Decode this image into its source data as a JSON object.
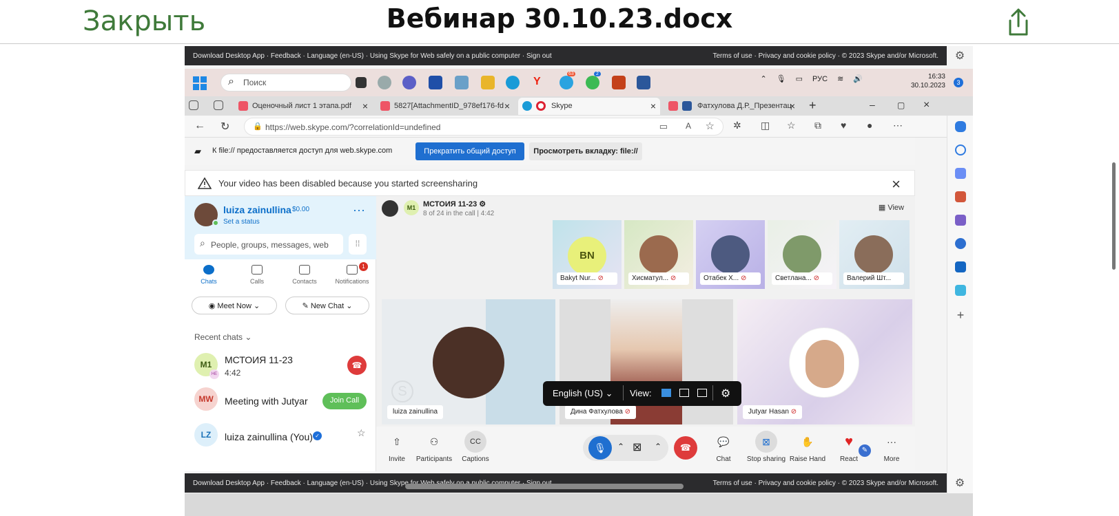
{
  "viewer": {
    "close_label": "Закрыть",
    "title": "Вебинар 30.10.23.docx",
    "share_icon": "share-icon"
  },
  "skype_footer": {
    "download": "Download Desktop App",
    "feedback": "Feedback",
    "language": "Language (en-US)",
    "public": "Using Skype for Web safely on a public computer",
    "signout": "Sign out",
    "terms": "Terms of use",
    "privacy": "Privacy and cookie policy",
    "copyright": "© 2023 Skype and/or Microsoft."
  },
  "taskbar": {
    "search_placeholder": "Поиск",
    "lang": "РУС",
    "time": "16:33",
    "date": "30.10.2023",
    "notif_count": "3",
    "badge_2": "2",
    "badge_3": "63"
  },
  "tabs": [
    {
      "label": "Оценочный лист 1 этапа.pdf"
    },
    {
      "label": "5827[AttachmentID_978ef176-fd"
    },
    {
      "label": "Skype"
    },
    {
      "label": "Фатхулова Д.Р._Презентац"
    }
  ],
  "address": {
    "url": "https://web.skype.com/?correlationId=undefined"
  },
  "sharebar": {
    "text": "К file:// предоставляется доступ для web.skype.com",
    "stop_label": "Прекратить общий доступ",
    "view_label": "Просмотреть вкладку: file://"
  },
  "warning": {
    "text": "Your video has been disabled because you started screensharing"
  },
  "profile": {
    "name": "luiza zainullina",
    "balance": "$0.00",
    "status": "Set a status",
    "search_placeholder": "People, groups, messages, web"
  },
  "nav": [
    {
      "label": "Chats"
    },
    {
      "label": "Calls"
    },
    {
      "label": "Contacts"
    },
    {
      "label": "Notifications",
      "badge": "1"
    }
  ],
  "buttons": {
    "meet_now": "Meet Now",
    "new_chat": "New Chat"
  },
  "recent": {
    "header": "Recent chats",
    "chats": [
      {
        "initials": "M1",
        "name": "МСТОИЯ 11-23",
        "sub": "4:42",
        "mini": "НЕ"
      },
      {
        "initials": "MW",
        "name": "Meeting with Jutyar",
        "action": "Join Call"
      },
      {
        "initials": "LZ",
        "name": "luiza zainullina (You)"
      }
    ]
  },
  "call": {
    "group_initials": "M1",
    "title": "МСТОИЯ 11-23",
    "subtitle": "8 of 24 in the call | 4:42",
    "view_label": "View",
    "thumbs": [
      {
        "label": "Bakyt Nur...",
        "initials": "BN"
      },
      {
        "label": "Хисматул..."
      },
      {
        "label": "Отабек Х..."
      },
      {
        "label": "Светлана..."
      },
      {
        "label": "Валерий Шт..."
      }
    ],
    "tiles": [
      {
        "label": "luiza zainullina"
      },
      {
        "label": "Дина Фатхулова"
      },
      {
        "label": "Jutyar Hasan"
      }
    ],
    "captions": {
      "language": "English (US)",
      "view": "View:"
    },
    "controls": {
      "invite": "Invite",
      "participants": "Participants",
      "captions": "Captions",
      "chat": "Chat",
      "stop_sharing": "Stop sharing",
      "raise_hand": "Raise Hand",
      "react": "React",
      "more": "More"
    }
  },
  "colors": {
    "accent": "#0b6ec9",
    "stop_button": "#1f6fd0",
    "end_call": "#de3b3b",
    "join_call": "#5fbf59",
    "close_text": "#3f7a3a"
  }
}
